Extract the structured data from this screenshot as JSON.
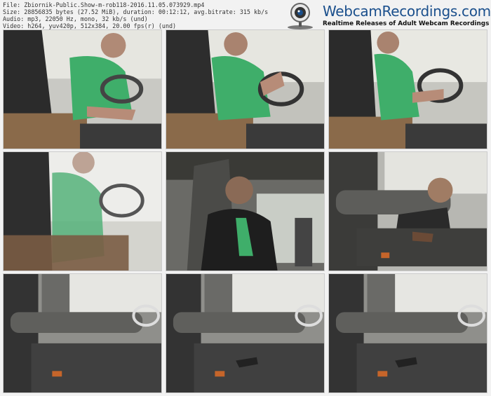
{
  "file_info": {
    "line1": "File: Zbiornik-Public.Show-m-rob118-2016.11.05.073929.mp4",
    "line2": "Size: 28856835 bytes (27.52 MiB), duration: 00:12:12, avg.bitrate: 315 kb/s",
    "line3": "Audio: mp3, 22050 Hz, mono, 32 kb/s (und)",
    "line4": "Video: h264, yuv420p, 512x384, 20.00 fps(r) (und)"
  },
  "logo": {
    "title": "WebcamRecordings.com",
    "tagline": "Realtime Releases of Adult Webcam Recordings"
  },
  "thumbnails": [
    {
      "scene": "driver-green-shirt"
    },
    {
      "scene": "driver-green-shirt"
    },
    {
      "scene": "driver-green-shirt"
    },
    {
      "scene": "driver-close-blur"
    },
    {
      "scene": "man-face-dark-jacket"
    },
    {
      "scene": "seat-man-reaching"
    },
    {
      "scene": "empty-seat"
    },
    {
      "scene": "empty-seat-keys"
    },
    {
      "scene": "empty-seat-keys"
    }
  ]
}
